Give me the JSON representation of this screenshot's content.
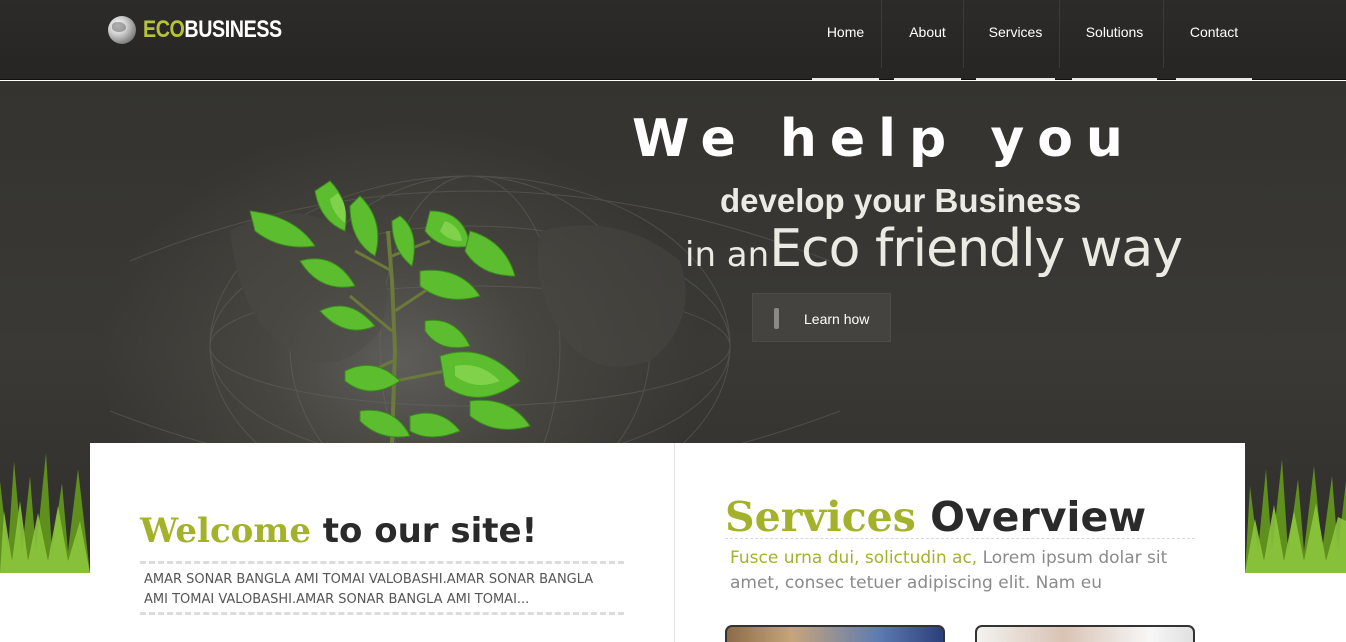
{
  "header": {
    "logo": {
      "eco": "ECO",
      "business": "BUSINESS",
      "icon": "globe-icon"
    },
    "nav": [
      {
        "label": "Home"
      },
      {
        "label": "About"
      },
      {
        "label": "Services"
      },
      {
        "label": "Solutions"
      },
      {
        "label": "Contact"
      }
    ]
  },
  "hero": {
    "line1": "We help you",
    "line2": "develop your Business",
    "line3_small": "in an",
    "line3_big": "Eco friendly way",
    "button_label": "Learn how"
  },
  "welcome": {
    "title_accent": "Welcome",
    "title_rest": " to our site!",
    "text": "AMAR SONAR BANGLA AMI TOMAI VALOBASHI.AMAR SONAR BANGLA AMI TOMAI VALOBASHI.AMAR SONAR BANGLA AMI TOMAI..."
  },
  "services": {
    "title_accent": "Services",
    "title_rest": " Overview",
    "text_accent": "Fusce urna dui, solictudin ac,",
    "text_rest": " Lorem ipsum dolar sit amet, consec tetuer adipiscing elit. Nam eu"
  },
  "colors": {
    "accent": "#a4b22b",
    "header_bg": "#2a2927",
    "hero_bg": "#393834",
    "text_dark": "#2a2a2a"
  }
}
